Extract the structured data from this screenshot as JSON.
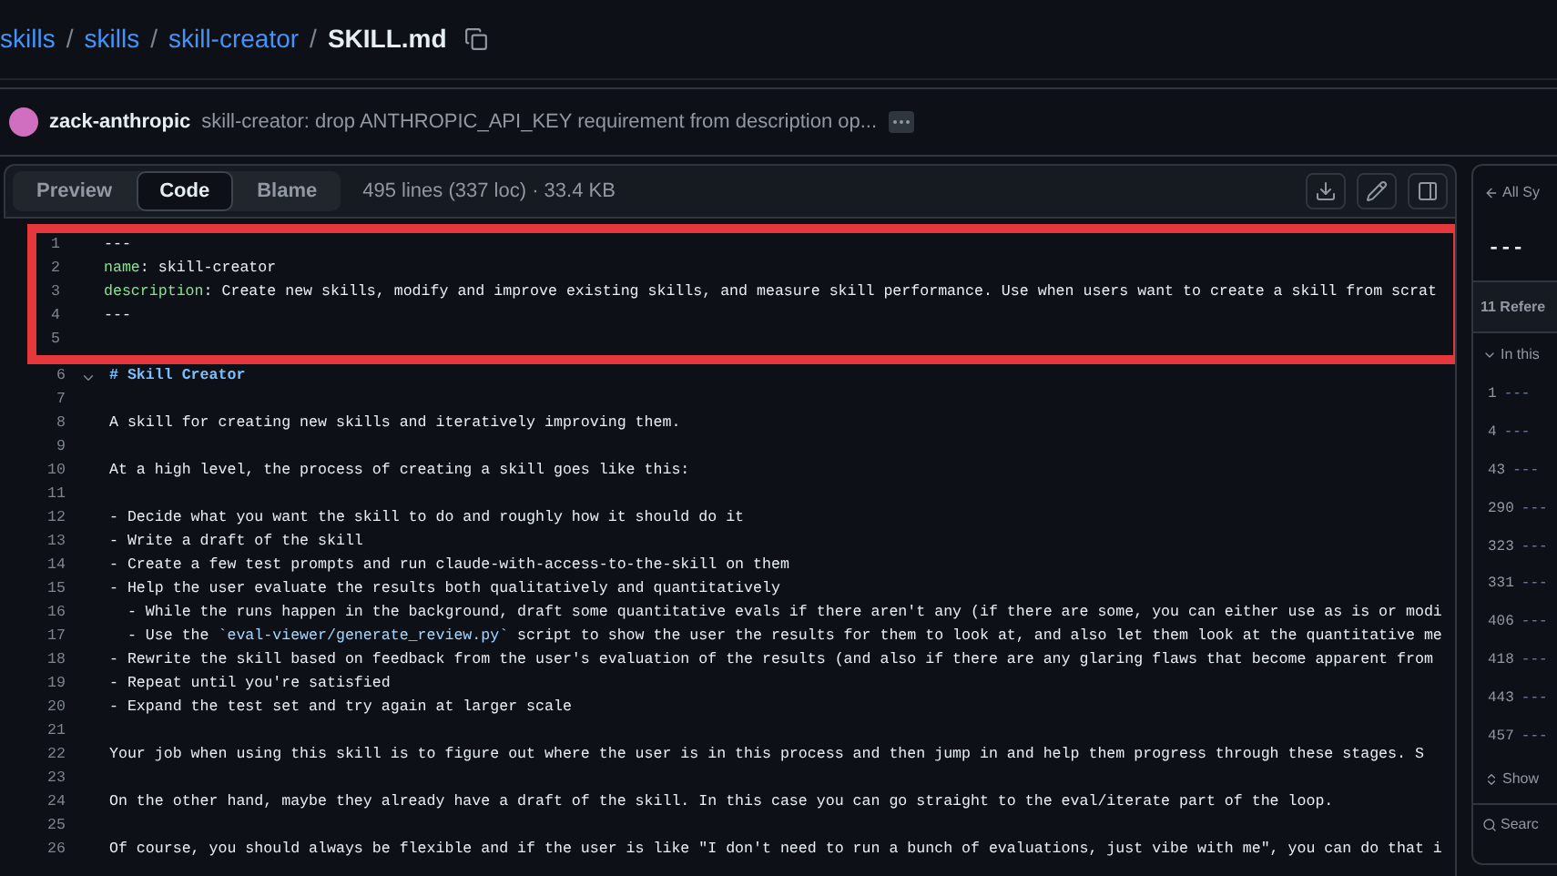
{
  "breadcrumb": {
    "parts": [
      "skills",
      "skills",
      "skill-creator"
    ],
    "separator": "/",
    "file": "SKILL.md"
  },
  "commit": {
    "author": "zack-anthropic",
    "message": "skill-creator: drop ANTHROPIC_API_KEY requirement from description op..."
  },
  "tabs": [
    {
      "label": "Preview",
      "selected": false
    },
    {
      "label": "Code",
      "selected": true
    },
    {
      "label": "Blame",
      "selected": false
    }
  ],
  "file_info": "495 lines (337 loc) · 33.4 KB",
  "code_lines": [
    {
      "number": "1",
      "highlighted": true,
      "segments": [
        {
          "kind": "plain",
          "text": "---"
        }
      ]
    },
    {
      "number": "2",
      "highlighted": true,
      "segments": [
        {
          "kind": "key",
          "text": "name"
        },
        {
          "kind": "plain",
          "text": ": skill-creator"
        }
      ]
    },
    {
      "number": "3",
      "highlighted": true,
      "segments": [
        {
          "kind": "key",
          "text": "description"
        },
        {
          "kind": "plain",
          "text": ": Create new skills, modify and improve existing skills, and measure skill performance. Use when users want to create a skill from scrat"
        }
      ]
    },
    {
      "number": "4",
      "highlighted": true,
      "segments": [
        {
          "kind": "plain",
          "text": "---"
        }
      ]
    },
    {
      "number": "5",
      "highlighted": true
    },
    {
      "number": "6",
      "highlighted": false,
      "foldable": true,
      "segments": [
        {
          "kind": "heading",
          "text": "# Skill Creator"
        }
      ]
    },
    {
      "number": "7",
      "highlighted": false
    },
    {
      "number": "8",
      "highlighted": false,
      "segments": [
        {
          "kind": "plain",
          "text": "A skill for creating new skills and iteratively improving them."
        }
      ]
    },
    {
      "number": "9",
      "highlighted": false
    },
    {
      "number": "10",
      "highlighted": false,
      "segments": [
        {
          "kind": "plain",
          "text": "At a high level, the process of creating a skill goes like this:"
        }
      ]
    },
    {
      "number": "11",
      "highlighted": false
    },
    {
      "number": "12",
      "highlighted": false,
      "segments": [
        {
          "kind": "plain",
          "text": "- Decide what you want the skill to do and roughly how it should do it"
        }
      ]
    },
    {
      "number": "13",
      "highlighted": false,
      "segments": [
        {
          "kind": "plain",
          "text": "- Write a draft of the skill"
        }
      ]
    },
    {
      "number": "14",
      "highlighted": false,
      "segments": [
        {
          "kind": "plain",
          "text": "- Create a few test prompts and run claude-with-access-to-the-skill on them"
        }
      ]
    },
    {
      "number": "15",
      "highlighted": false,
      "segments": [
        {
          "kind": "plain",
          "text": "- Help the user evaluate the results both qualitatively and quantitatively"
        }
      ]
    },
    {
      "number": "16",
      "highlighted": false,
      "segments": [
        {
          "kind": "plain",
          "text": "  - While the runs happen in the background, draft some quantitative evals if there aren't any (if there are some, you can either use as is or modi"
        }
      ]
    },
    {
      "number": "17",
      "highlighted": false,
      "segments": [
        {
          "kind": "plain",
          "text": "  - Use the "
        },
        {
          "kind": "code",
          "text": "`eval-viewer/generate_review.py`"
        },
        {
          "kind": "plain",
          "text": " script to show the user the results for them to look at, and also let them look at the quantitative me"
        }
      ]
    },
    {
      "number": "18",
      "highlighted": false,
      "segments": [
        {
          "kind": "plain",
          "text": "- Rewrite the skill based on feedback from the user's evaluation of the results (and also if there are any glaring flaws that become apparent from"
        }
      ]
    },
    {
      "number": "19",
      "highlighted": false,
      "segments": [
        {
          "kind": "plain",
          "text": "- Repeat until you're satisfied"
        }
      ]
    },
    {
      "number": "20",
      "highlighted": false,
      "segments": [
        {
          "kind": "plain",
          "text": "- Expand the test set and try again at larger scale"
        }
      ]
    },
    {
      "number": "21",
      "highlighted": false
    },
    {
      "number": "22",
      "highlighted": false,
      "segments": [
        {
          "kind": "plain",
          "text": "Your job when using this skill is to figure out where the user is in this process and then jump in and help them progress through these stages. S"
        }
      ]
    },
    {
      "number": "23",
      "highlighted": false
    },
    {
      "number": "24",
      "highlighted": false,
      "segments": [
        {
          "kind": "plain",
          "text": "On the other hand, maybe they already have a draft of the skill. In this case you can go straight to the eval/iterate part of the loop."
        }
      ]
    },
    {
      "number": "25",
      "highlighted": false
    },
    {
      "number": "26",
      "highlighted": false,
      "segments": [
        {
          "kind": "plain",
          "text": "Of course, you should always be flexible and if the user is like \"I don't need to run a bunch of evaluations, just vibe with me\", you can do that i"
        }
      ]
    }
  ],
  "symbols_panel": {
    "back": "All Sy",
    "title": "---",
    "references": "11 Refere",
    "section": "In this",
    "expanded": true,
    "items": [
      {
        "line": "1",
        "symbol": "---"
      },
      {
        "line": "4",
        "symbol": "---"
      },
      {
        "line": "43",
        "symbol": "---"
      },
      {
        "line": "290",
        "symbol": "---"
      },
      {
        "line": "323",
        "symbol": "---"
      },
      {
        "line": "331",
        "symbol": "---"
      },
      {
        "line": "406",
        "symbol": "---"
      },
      {
        "line": "418",
        "symbol": "---"
      },
      {
        "line": "443",
        "symbol": "---"
      },
      {
        "line": "457",
        "symbol": "---"
      }
    ],
    "show": "Show",
    "search": "Searc"
  }
}
